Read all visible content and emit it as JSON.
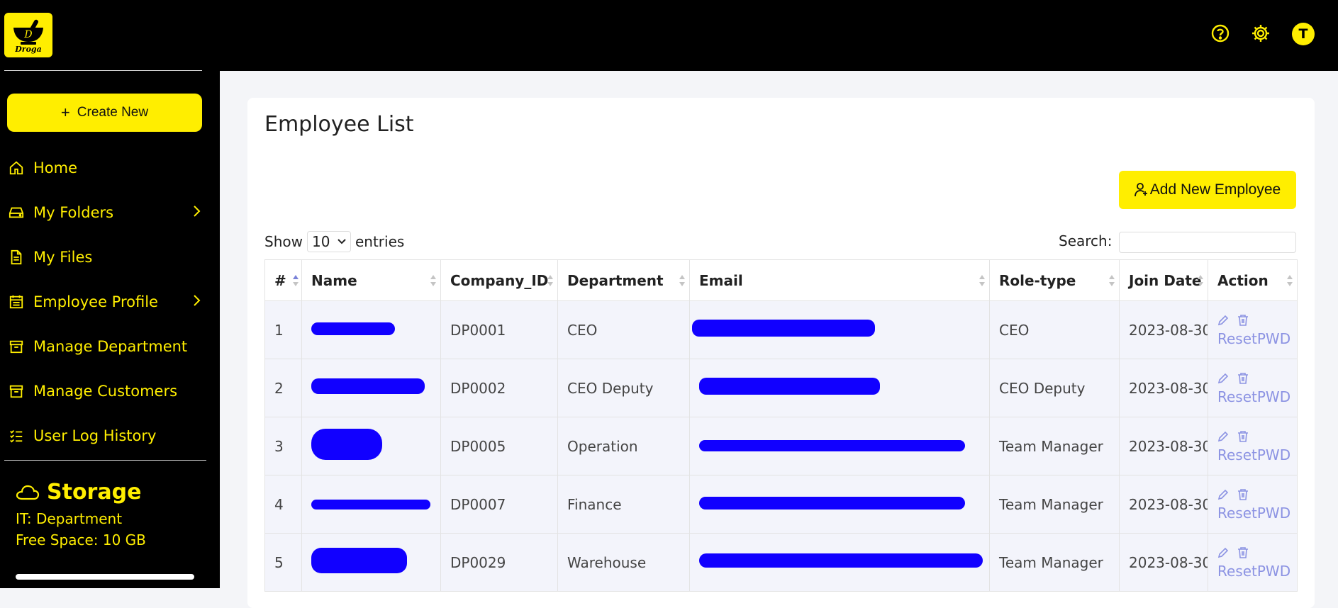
{
  "app": {
    "logo_text": "Droga"
  },
  "sidebar": {
    "create_label": "Create New",
    "items": [
      {
        "label": "Home",
        "icon": "home-icon",
        "has_chevron": false
      },
      {
        "label": "My Folders",
        "icon": "drive-icon",
        "has_chevron": true
      },
      {
        "label": "My Files",
        "icon": "file-icon",
        "has_chevron": false
      },
      {
        "label": "Employee Profile",
        "icon": "profile-icon",
        "has_chevron": true
      },
      {
        "label": "Manage Department",
        "icon": "archive-icon",
        "has_chevron": false
      },
      {
        "label": "Manage Customers",
        "icon": "archive-icon",
        "has_chevron": false
      },
      {
        "label": "User Log History",
        "icon": "list-icon",
        "has_chevron": false
      }
    ],
    "storage": {
      "title": "Storage",
      "department": "IT: Department",
      "free_space": "Free Space: 10 GB"
    }
  },
  "topbar": {
    "help_icon": "help-icon",
    "settings_icon": "gear-icon",
    "avatar_initial": "T"
  },
  "page": {
    "title": "Employee List",
    "add_button": "Add New Employee",
    "show_label": "Show",
    "entries_value": "10",
    "entries_label": "entries",
    "search_label": "Search:",
    "search_value": ""
  },
  "table": {
    "columns": [
      "#",
      "Name",
      "Company_ID",
      "Department",
      "Email",
      "Role-type",
      "Join Date",
      "Action"
    ],
    "action_link": "ResetPWD",
    "rows": [
      {
        "num": "1",
        "company_id": "DP0001",
        "department": "CEO",
        "role": "CEO",
        "join_date": "2023-08-30"
      },
      {
        "num": "2",
        "company_id": "DP0002",
        "department": "CEO Deputy",
        "role": "CEO Deputy",
        "join_date": "2023-08-30"
      },
      {
        "num": "3",
        "company_id": "DP0005",
        "department": "Operation",
        "role": "Team Manager",
        "join_date": "2023-08-30"
      },
      {
        "num": "4",
        "company_id": "DP0007",
        "department": "Finance",
        "role": "Team Manager",
        "join_date": "2023-08-30"
      },
      {
        "num": "5",
        "company_id": "DP0029",
        "department": "Warehouse",
        "role": "Team Manager",
        "join_date": "2023-08-30"
      }
    ]
  },
  "colors": {
    "accent": "#ffee00",
    "sidebar_bg": "#000000",
    "link": "#8c93e3",
    "redaction": "#1100ff"
  }
}
